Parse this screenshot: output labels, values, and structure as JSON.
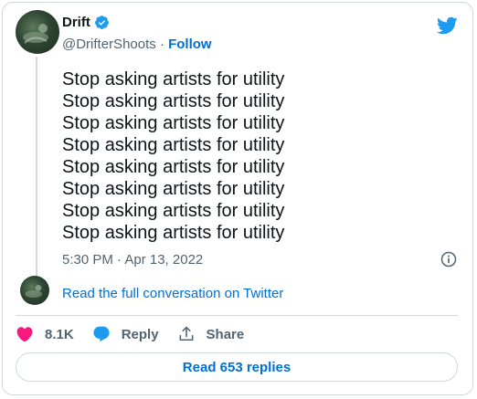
{
  "author": {
    "name": "Drift",
    "handle": "@DrifterShoots",
    "separator": "·",
    "follow_label": "Follow",
    "verified": true
  },
  "tweet": {
    "lines": [
      "Stop asking artists for utility",
      "Stop asking artists for utility",
      "Stop asking artists for utility",
      "Stop asking artists for utility",
      "Stop asking artists for utility",
      "Stop asking artists for utility",
      "Stop asking artists for utility",
      "Stop asking artists for utility"
    ],
    "timestamp": "5:30 PM · Apr 13, 2022"
  },
  "conversation": {
    "read_full_label": "Read the full conversation on Twitter"
  },
  "actions": {
    "like_count": "8.1K",
    "reply_label": "Reply",
    "share_label": "Share"
  },
  "replies_button_label": "Read 653 replies",
  "icons": {
    "brand": "twitter-bird-icon",
    "verified": "verified-badge-icon",
    "info": "info-icon",
    "like": "heart-icon",
    "reply": "reply-bubble-icon",
    "share": "share-icon"
  },
  "colors": {
    "link": "#006fd6",
    "verified": "#1d9bf0",
    "brand": "#1d9bf0",
    "like": "#f91880",
    "muted": "#536471",
    "border": "#cfd9de"
  }
}
